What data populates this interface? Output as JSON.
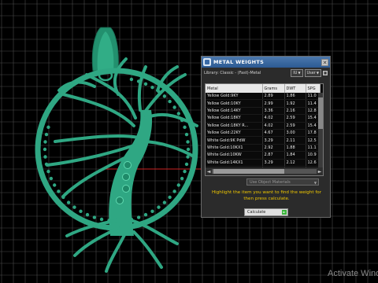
{
  "panel": {
    "title": "METAL WEIGHTS",
    "close_icon": "close-icon",
    "library_label": "Library: Classic - (Fast)-Metal",
    "unit_label": "IU",
    "user_label": "User",
    "columns": [
      "Metal",
      "Grams",
      "DWT",
      "SPG"
    ],
    "rows": [
      [
        "Yellow Gold:9KY",
        "2.89",
        "1.86",
        "11.0"
      ],
      [
        "Yellow Gold:10KY",
        "2.99",
        "1.92",
        "11.4"
      ],
      [
        "Yellow Gold:14KY",
        "3.36",
        "2.16",
        "12.8"
      ],
      [
        "Yellow Gold:18KY",
        "4.02",
        "2.59",
        "15.4"
      ],
      [
        "Yellow Gold:18KY R...",
        "4.02",
        "2.59",
        "15.4"
      ],
      [
        "Yellow Gold:22KY",
        "4.67",
        "3.00",
        "17.8"
      ],
      [
        "White Gold:9K PdW",
        "3.29",
        "2.11",
        "12.5"
      ],
      [
        "White Gold:10KX1",
        "2.92",
        "1.88",
        "11.1"
      ],
      [
        "White Gold:10KW",
        "2.87",
        "1.84",
        "10.9"
      ],
      [
        "White Gold:14KX1",
        "3.29",
        "2.12",
        "12.6"
      ],
      [
        "White Gold:14K PdW",
        "3.75",
        "2.41",
        "14.3"
      ]
    ],
    "object_materials": "Use Object Materials",
    "hint": "Highlight the item you want to find the weight for then press calculate.",
    "calculate_label": "Calculate"
  },
  "watermark": "Activate Wind",
  "colors": {
    "pendant": "#2fa783",
    "grid": "#4a4a4a",
    "axis": "#cc2222",
    "hint": "#f0c800"
  }
}
